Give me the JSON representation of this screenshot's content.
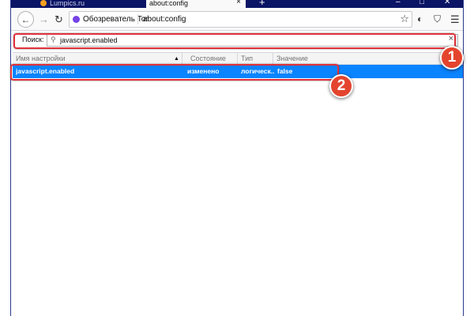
{
  "tabs": [
    {
      "label": "Lumpics.ru",
      "active": false
    },
    {
      "label": "about:config",
      "active": true
    }
  ],
  "toolbar": {
    "new_tab_icon": "+",
    "identity_label": "Обозреватель Tor",
    "url": "about:config"
  },
  "search": {
    "label": "Поиск:",
    "value": "javascript.enabled"
  },
  "table": {
    "columns": [
      "Имя настройки",
      "Состояние",
      "Тип",
      "Значение"
    ],
    "sort_column": "Имя настройки",
    "rows": [
      {
        "name": "javascript.enabled",
        "state": "изменено",
        "type": "логическ...",
        "value": "false",
        "selected": true
      }
    ]
  },
  "annotations": {
    "badge_1": "1",
    "badge_2": "2",
    "color": "#e0303a"
  },
  "colors": {
    "titlebar": "#0b1565",
    "selection": "#0a84ff",
    "tor_purple": "#7542e5"
  }
}
